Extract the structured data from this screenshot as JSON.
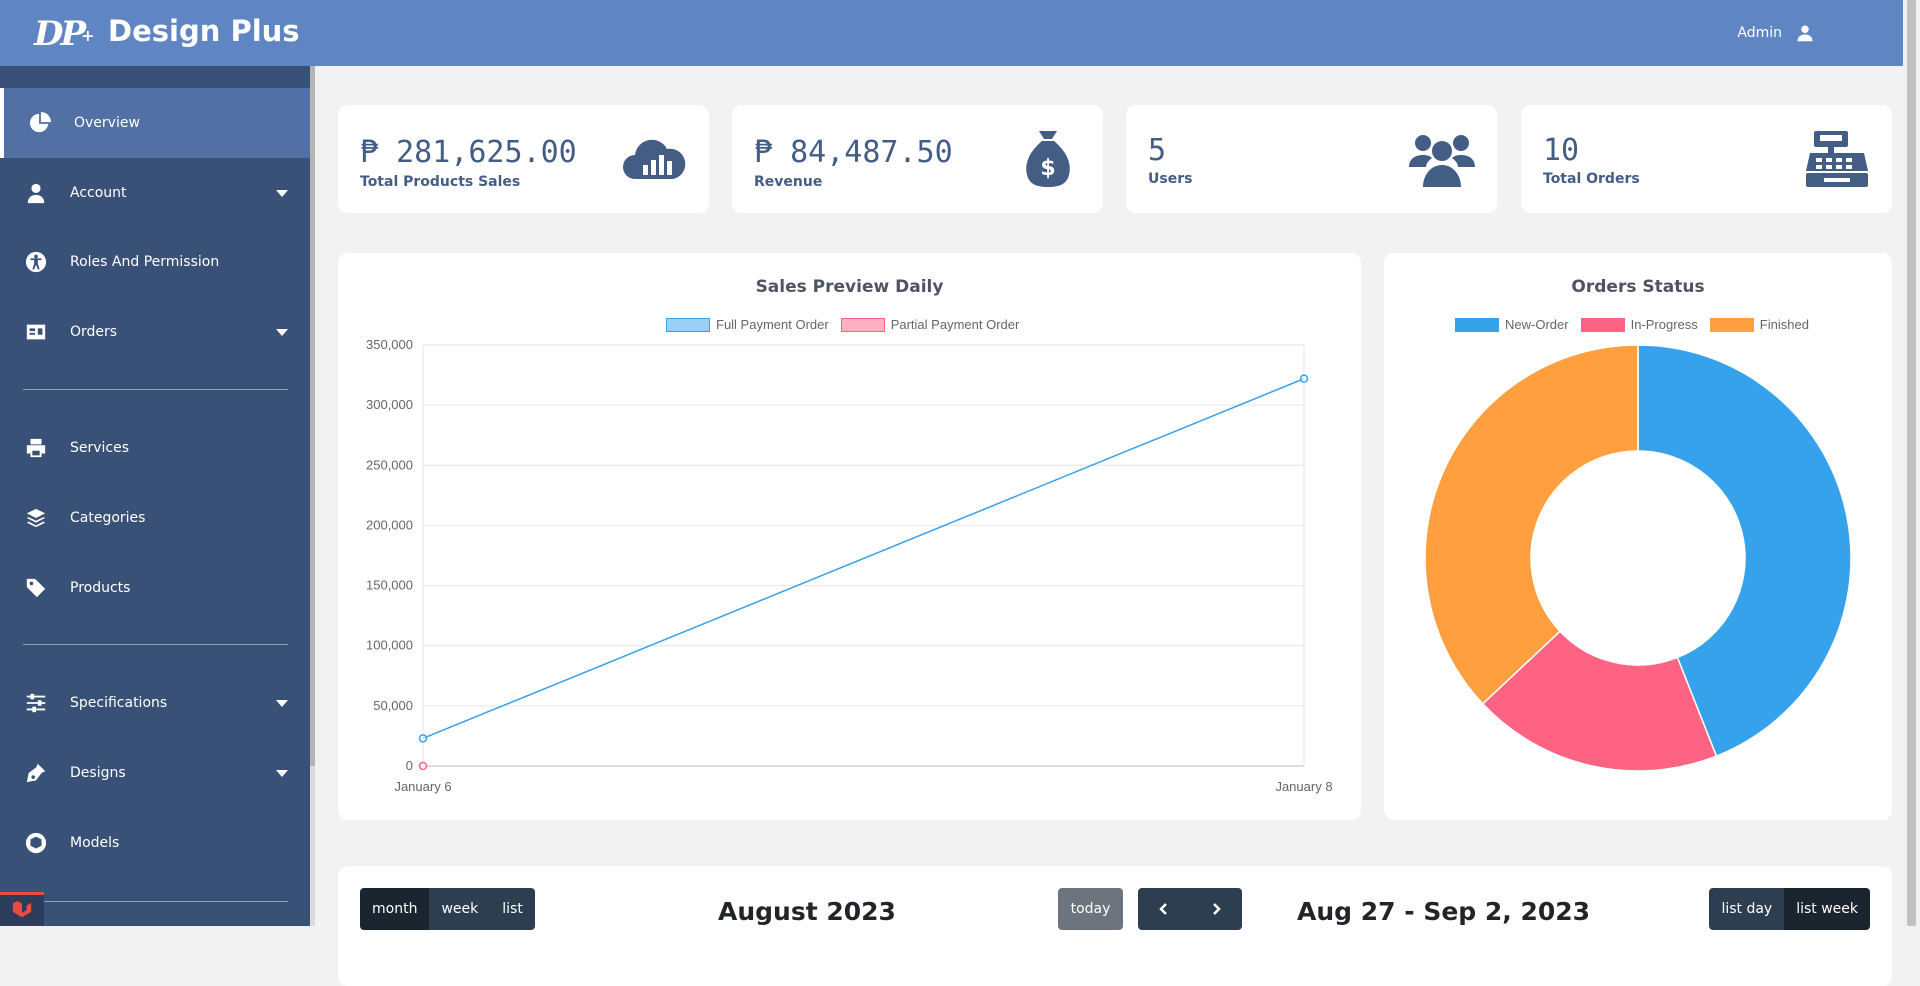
{
  "header": {
    "logo_text": "DP",
    "logo_plus": "+",
    "brand": "Design Plus",
    "user": "Admin"
  },
  "sidebar": {
    "items": [
      {
        "label": "Overview",
        "icon": "pie-chart-icon"
      },
      {
        "label": "Account",
        "icon": "user-icon"
      },
      {
        "label": "Roles And Permission",
        "icon": "accessibility-icon"
      },
      {
        "label": "Orders",
        "icon": "id-card-icon"
      },
      {
        "label": "Services",
        "icon": "printer-icon"
      },
      {
        "label": "Categories",
        "icon": "layers-icon"
      },
      {
        "label": "Products",
        "icon": "tags-icon"
      },
      {
        "label": "Specifications",
        "icon": "sliders-icon"
      },
      {
        "label": "Designs",
        "icon": "pen-nib-icon"
      },
      {
        "label": "Models",
        "icon": "cube-icon"
      }
    ]
  },
  "stats": [
    {
      "value": "₱ 281,625.00",
      "label": "Total Products Sales",
      "icon": "cloud-chart-icon"
    },
    {
      "value": "₱ 84,487.50",
      "label": "Revenue",
      "icon": "money-bag-icon"
    },
    {
      "value": "5",
      "label": "Users",
      "icon": "users-icon"
    },
    {
      "value": "10",
      "label": "Total Orders",
      "icon": "cash-register-icon"
    }
  ],
  "colors": {
    "header": "#5f86c2",
    "sidebar": "#3a5177",
    "accent": "#445d84",
    "series_full": "#36a2eb",
    "series_partial": "#ff6384",
    "finished": "#ff9f40"
  },
  "chart_data": [
    {
      "type": "line",
      "title": "Sales Preview Daily",
      "x": [
        "January 6",
        "January 8"
      ],
      "series": [
        {
          "name": "Full Payment Order",
          "values": [
            23000,
            322000
          ]
        },
        {
          "name": "Partial Payment Order",
          "values": [
            0,
            null
          ]
        }
      ],
      "ylim": [
        0,
        350000
      ],
      "yticks": [
        "350,000",
        "300,000",
        "250,000",
        "200,000",
        "150,000",
        "100,000",
        "50,000",
        "0"
      ],
      "xlabel": "",
      "ylabel": "",
      "grid": true,
      "legend": "top"
    },
    {
      "type": "pie",
      "title": "Orders Status",
      "labels": [
        "New-Order",
        "In-Progress",
        "Finished"
      ],
      "values": [
        4.4,
        1.9,
        3.7
      ],
      "doughnut": true,
      "legend": "top"
    }
  ],
  "calendar_month": {
    "views": [
      "month",
      "week",
      "list"
    ],
    "title": "August 2023",
    "today": "today"
  },
  "calendar_list": {
    "title": "Aug 27 - Sep 2, 2023",
    "views": [
      "list day",
      "list week"
    ]
  }
}
